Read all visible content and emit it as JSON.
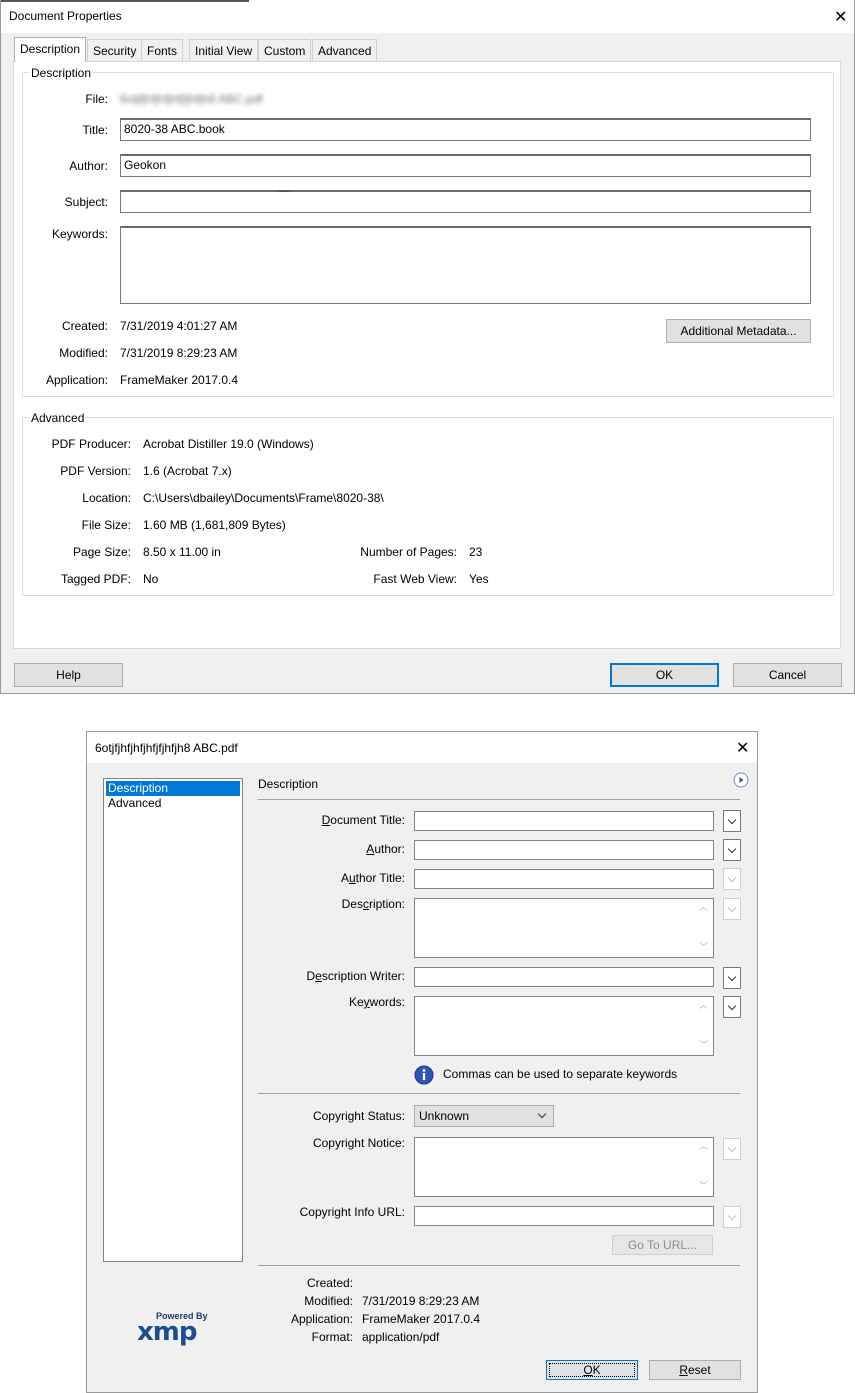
{
  "dialog1": {
    "title": "Document Properties",
    "tabs": [
      "Description",
      "Security",
      "Fonts",
      "Initial View",
      "Custom",
      "Advanced"
    ],
    "description_group": {
      "legend": "Description",
      "file_label": "File:",
      "file_value": "6otjfjhfjhfjhfjfjhfjh8 ABC.pdf",
      "title_label": "Title:",
      "title_value": "8020-38 ABC.book",
      "author_label": "Author:",
      "author_value": "Geokon",
      "subject_label": "Subject:",
      "subject_value": "",
      "keywords_label": "Keywords:",
      "keywords_value": "",
      "created_label": "Created:",
      "created_value": "7/31/2019 4:01:27 AM",
      "modified_label": "Modified:",
      "modified_value": "7/31/2019 8:29:23 AM",
      "application_label": "Application:",
      "application_value": "FrameMaker 2017.0.4",
      "additional_metadata_button": "Additional Metadata..."
    },
    "advanced_group": {
      "legend": "Advanced",
      "producer_label": "PDF Producer:",
      "producer_value": "Acrobat Distiller 19.0 (Windows)",
      "version_label": "PDF Version:",
      "version_value": "1.6 (Acrobat 7.x)",
      "location_label": "Location:",
      "location_value": "C:\\Users\\dbailey\\Documents\\Frame\\8020-38\\",
      "filesize_label": "File Size:",
      "filesize_value": "1.60 MB (1,681,809 Bytes)",
      "pagesize_label": "Page Size:",
      "pagesize_value": "8.50 x 11.00 in",
      "numpages_label": "Number of Pages:",
      "numpages_value": "23",
      "tagged_label": "Tagged PDF:",
      "tagged_value": "No",
      "fastweb_label": "Fast Web View:",
      "fastweb_value": "Yes"
    },
    "buttons": {
      "help": "Help",
      "ok": "OK",
      "cancel": "Cancel"
    }
  },
  "dialog2": {
    "title": "6otjfjhfjhfjhfjfjhfjh8 ABC.pdf",
    "sidebar": [
      "Description",
      "Advanced"
    ],
    "section_title": "Description",
    "fields": {
      "doc_title_label": "Document Title:",
      "doc_title_value": "",
      "author_label": "Author:",
      "author_value": "",
      "author_title_label": "Author Title:",
      "author_title_value": "",
      "description_label": "Description:",
      "description_value": "",
      "desc_writer_label": "Description Writer:",
      "desc_writer_value": "",
      "keywords_label": "Keywords:",
      "keywords_value": "",
      "keywords_hint": "Commas can be used to separate keywords",
      "copyright_status_label": "Copyright Status:",
      "copyright_status_value": "Unknown",
      "copyright_notice_label": "Copyright Notice:",
      "copyright_notice_value": "",
      "copyright_url_label": "Copyright Info URL:",
      "copyright_url_value": "",
      "go_to_url_button": "Go To URL..."
    },
    "info": {
      "created_label": "Created:",
      "created_value": "",
      "modified_label": "Modified:",
      "modified_value": "7/31/2019 8:29:23 AM",
      "application_label": "Application:",
      "application_value": "FrameMaker 2017.0.4",
      "format_label": "Format:",
      "format_value": "application/pdf"
    },
    "logo": {
      "powered_by": "Powered By",
      "name": "xmp"
    },
    "buttons": {
      "ok": "OK",
      "reset": "Reset"
    }
  }
}
